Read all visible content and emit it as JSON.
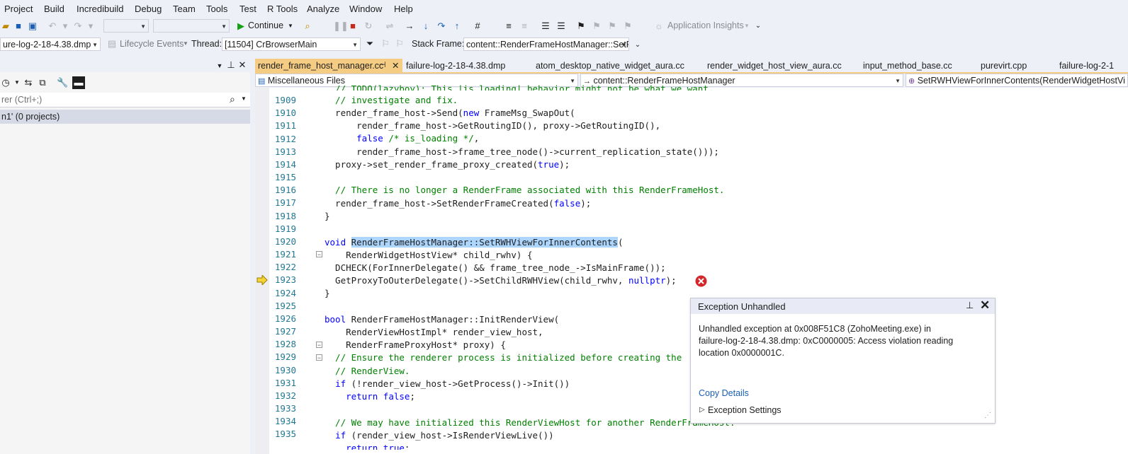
{
  "menu": [
    "Project",
    "Build",
    "Incredibuild",
    "Debug",
    "Team",
    "Tools",
    "Test",
    "R Tools",
    "Analyze",
    "Window",
    "Help"
  ],
  "toolbar": {
    "continue_label": "Continue",
    "app_insights_label": "Application Insights"
  },
  "debug_bar": {
    "dump_file": "ure-log-2-18-4.38.dmp",
    "lifecycle_label": "Lifecycle Events",
    "thread_label": "Thread:",
    "thread_value": "[11504] CrBrowserMain",
    "stack_frame_label": "Stack Frame:",
    "stack_frame_value": "content::RenderFrameHostManager::SetRʻ"
  },
  "left_panel": {
    "search_placeholder": "rer (Ctrl+;)",
    "solution_row": "n1' (0 projects)"
  },
  "tabs": [
    {
      "label": "render_frame_host_manager.cc",
      "active": true
    },
    {
      "label": "failure-log-2-18-4.38.dmp"
    },
    {
      "label": "atom_desktop_native_widget_aura.cc"
    },
    {
      "label": "render_widget_host_view_aura.cc"
    },
    {
      "label": "input_method_base.cc"
    },
    {
      "label": "purevirt.cpp"
    },
    {
      "label": "failure-log-2-1"
    }
  ],
  "navbar": {
    "project": "Miscellaneous Files",
    "scope": "content::RenderFrameHostManager",
    "member": "SetRWHViewForInnerContents(RenderWidgetHostVi"
  },
  "code": {
    "lines": [
      "1909",
      "1910",
      "1911",
      "1912",
      "1913",
      "1914",
      "1915",
      "1916",
      "1917",
      "1918",
      "1919",
      "1920",
      "1921",
      "1922",
      "1923",
      "1924",
      "1925",
      "1926",
      "1927",
      "1928",
      "1929",
      "1930",
      "1931",
      "1932",
      "1933",
      "1934",
      "1935"
    ]
  },
  "exception": {
    "title": "Exception Unhandled",
    "message": "Unhandled exception at 0x008F51C8 (ZohoMeeting.exe) in failure-log-2-18-4.38.dmp: 0xC0000005: Access violation reading location 0x0000001C.",
    "copy_details": "Copy Details",
    "settings": "Exception Settings"
  }
}
